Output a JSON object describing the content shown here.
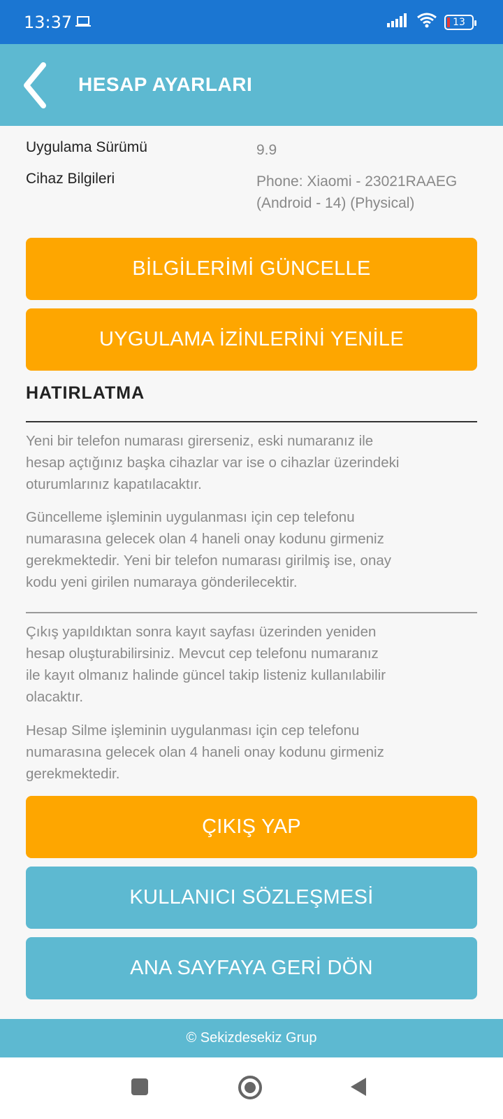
{
  "status_bar": {
    "time": "13:37",
    "battery_level": "13",
    "icons": [
      "laptop-icon",
      "signal-icon",
      "wifi-icon",
      "battery-icon"
    ]
  },
  "header": {
    "title": "HESAP AYARLARI"
  },
  "info": {
    "version_label": "Uygulama Sürümü",
    "version_value": "9.9",
    "device_label": "Cihaz Bilgileri",
    "device_value_line1": "Phone: Xiaomi - 23021RAAEG",
    "device_value_line2": "(Android - 14) (Physical)"
  },
  "buttons": {
    "update_info": "BİLGİLERİMİ GÜNCELLE",
    "renew_permissions": "UYGULAMA İZİNLERİNİ YENİLE",
    "logout": "ÇIKIŞ YAP",
    "user_agreement": "KULLANICI SÖZLEŞMESİ",
    "back_home": "ANA SAYFAYA GERİ DÖN"
  },
  "reminder": {
    "title": "HATIRLATMA",
    "p1": [
      "Yeni bir telefon numarası girerseniz, eski numaranız ile",
      "hesap açtığınız başka cihazlar var ise o cihazlar üzerindeki",
      "oturumlarınız kapatılacaktır."
    ],
    "p2": [
      "Güncelleme işleminin uygulanması için cep telefonu",
      "numarasına gelecek olan 4 haneli onay kodunu girmeniz",
      "gerekmektedir. Yeni bir telefon numarası girilmiş ise, onay",
      "kodu yeni girilen numaraya gönderilecektir."
    ],
    "p3": [
      "Çıkış yapıldıktan sonra kayıt sayfası üzerinden yeniden",
      "hesap oluşturabilirsiniz. Mevcut cep telefonu numaranız",
      "ile kayıt olmanız halinde güncel takip listeniz kullanılabilir",
      "olacaktır."
    ],
    "p4": [
      "Hesap Silme işleminin uygulanması için cep telefonu",
      "numarasına gelecek olan 4 haneli onay kodunu girmeniz",
      "gerekmektedir."
    ]
  },
  "footer": {
    "text": "© Sekizdesekiz Grup"
  },
  "colors": {
    "status_bar": "#1b76d2",
    "header": "#5db9d1",
    "orange": "#fea600",
    "blue": "#5db9d1"
  }
}
